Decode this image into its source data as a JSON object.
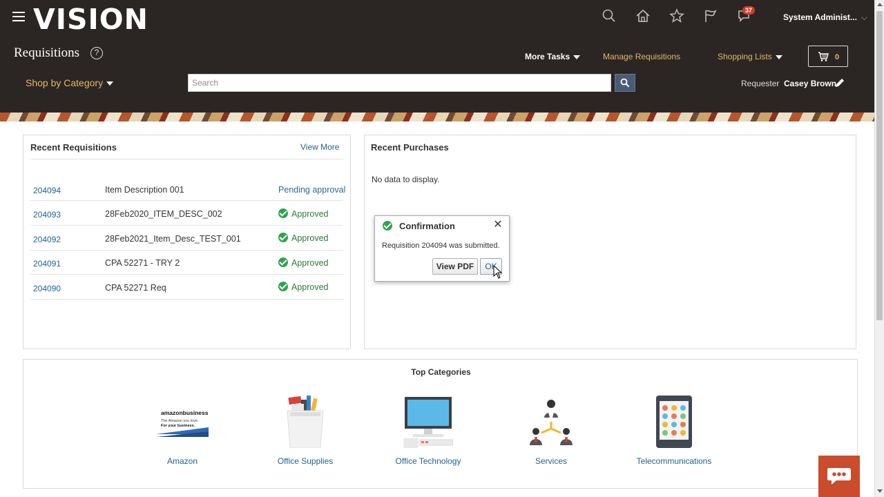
{
  "header": {
    "logo": "VISION",
    "notification_count": "37",
    "user": "System Administ...",
    "page_title": "Requisitions",
    "help_glyph": "?",
    "more_tasks": "More Tasks",
    "manage_requisitions": "Manage Requisitions",
    "shopping_lists": "Shopping Lists",
    "cart_count": "0",
    "shop_by_category": "Shop by Category",
    "search_placeholder": "Search",
    "requester_label": "Requester",
    "requester_name": "Casey Brown",
    "icons": [
      "hamburger-icon",
      "search-icon",
      "home-icon",
      "star-icon",
      "flag-icon",
      "notifications-icon",
      "cart-icon",
      "edit-icon"
    ]
  },
  "recent_requisitions": {
    "title": "Recent Requisitions",
    "view_more": "View More",
    "rows": [
      {
        "id": "204094",
        "description": "Item Description 001",
        "status": "Pending approval"
      },
      {
        "id": "204093",
        "description": "28Feb2020_ITEM_DESC_002",
        "status": "Approved"
      },
      {
        "id": "204092",
        "description": "28Feb2021_Item_Desc_TEST_001",
        "status": "Approved"
      },
      {
        "id": "204091",
        "description": "CPA 52271 - TRY 2",
        "status": "Approved"
      },
      {
        "id": "204090",
        "description": "CPA 52271 Req",
        "status": "Approved"
      }
    ]
  },
  "recent_purchases": {
    "title": "Recent Purchases",
    "empty_text": "No data to display."
  },
  "confirmation": {
    "title": "Confirmation",
    "message": "Requisition 204094 was submitted.",
    "view_pdf": "View PDF",
    "ok": "OK"
  },
  "top_categories": {
    "title": "Top Categories",
    "items": [
      {
        "label": "Amazon",
        "logo_brand": "amazonbusiness",
        "logo_tagline_1": "The Amazon you love.",
        "logo_tagline_2": "For your business."
      },
      {
        "label": "Office Supplies"
      },
      {
        "label": "Office Technology"
      },
      {
        "label": "Services"
      },
      {
        "label": "Telecommunications"
      }
    ]
  },
  "colors": {
    "header_bg": "#2b2623",
    "accent_gold": "#e3b76b",
    "link_blue": "#1f6293",
    "approved_green": "#2da44e",
    "chat_orange": "#cb4b2d"
  }
}
